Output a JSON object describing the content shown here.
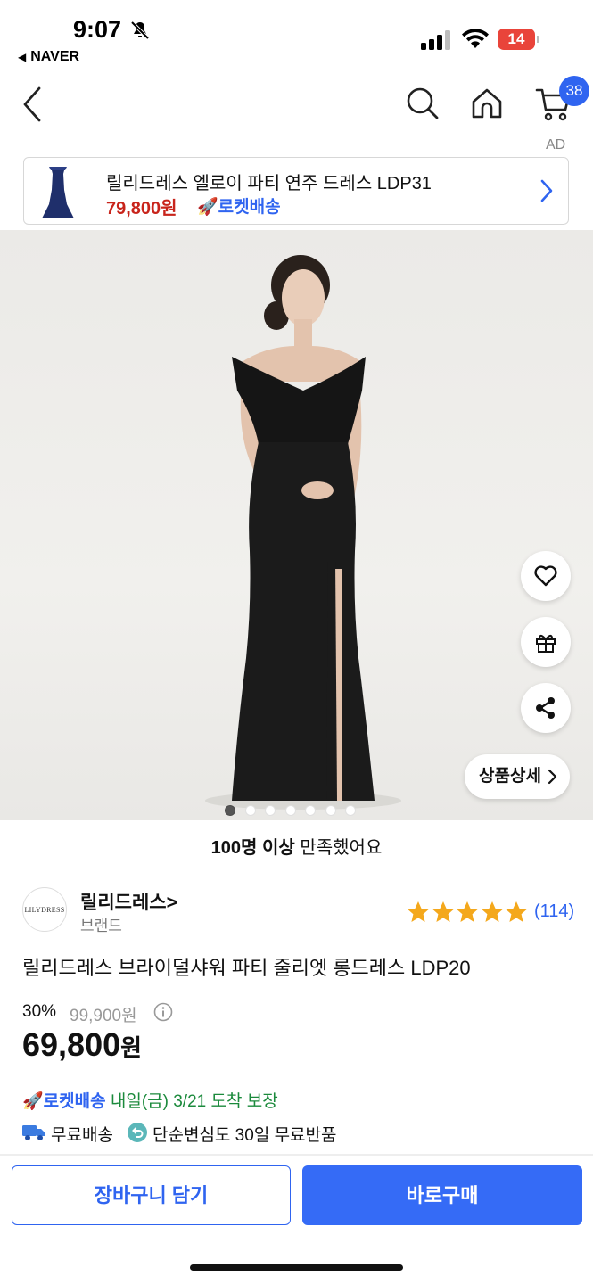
{
  "status_bar": {
    "time": "9:07",
    "back_app": "NAVER",
    "battery": "14",
    "icons": [
      "bell-slash-icon",
      "signal-icon",
      "wifi-icon",
      "battery-icon"
    ]
  },
  "nav": {
    "cart_count": "38",
    "icons": [
      "back-icon",
      "search-icon",
      "home-icon",
      "cart-icon"
    ]
  },
  "ad": {
    "label": "AD",
    "title": "릴리드레스 엘로이 파티 연주 드레스 LDP31",
    "price": "79,800원",
    "delivery": "🚀로켓배송"
  },
  "gallery": {
    "detail_button": "상품상세",
    "dot_count": 7,
    "active_dot": 0,
    "side_icons": [
      "heart-icon",
      "gift-icon",
      "share-icon"
    ]
  },
  "satisfaction": {
    "bold": "100명 이상",
    "rest": " 만족했어요"
  },
  "brand": {
    "logo_text": "LILYDRESS",
    "name": "릴리드레스>",
    "sub": "브랜드",
    "rating": 5,
    "review_count": "(114)"
  },
  "product": {
    "title": "릴리드레스 브라이덜샤워 파티 줄리엣 롱드레스 LDP20",
    "discount": "30%",
    "original_price": "99,900원",
    "price_number": "69,800",
    "price_unit": "원"
  },
  "shipping": {
    "rocket_label": "🚀로켓배송",
    "rocket_eta": " 내일(금) 3/21 도착 보장",
    "free_shipping": "무료배송",
    "free_return": "단순변심도 30일 무료반품"
  },
  "actions": {
    "cart": "장바구니 담기",
    "buy": "바로구매"
  },
  "colors": {
    "accent": "#2f64f0",
    "price_red": "#c8241b",
    "eta_green": "#1b8a3c"
  }
}
